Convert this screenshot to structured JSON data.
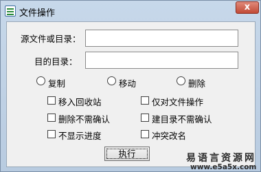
{
  "window": {
    "title": "文件操作",
    "close_glyph": "x"
  },
  "fields": {
    "source_label": "源文件或目录：",
    "source_value": "",
    "target_label": "目的目录：",
    "target_value": ""
  },
  "operations": [
    {
      "label": "复制",
      "selected": false
    },
    {
      "label": "移动",
      "selected": false
    },
    {
      "label": "删除",
      "selected": false
    }
  ],
  "options": [
    {
      "label": "移入回收站",
      "checked": false
    },
    {
      "label": "仅对文件操作",
      "checked": false
    },
    {
      "label": "删除不需确认",
      "checked": false
    },
    {
      "label": "建目录不需确认",
      "checked": false
    },
    {
      "label": "不显示进度",
      "checked": false
    },
    {
      "label": "冲突改名",
      "checked": false
    }
  ],
  "execute_button": "执行",
  "watermark": {
    "text": "易语言资源网",
    "url": "www.e5a5x.com"
  }
}
